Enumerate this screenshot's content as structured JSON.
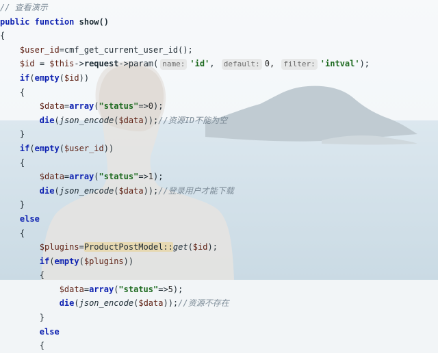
{
  "code": {
    "comment_title": "// 查看演示",
    "func_decl_kw1": "public",
    "func_decl_kw2": "function",
    "func_name": "show()",
    "open_brace": "{",
    "close_brace": "}",
    "line_user_id_var": "$user_id",
    "line_user_id_call": "=cmf_get_current_user_id();",
    "line_id_var": "$id",
    "line_id_eq": " = ",
    "line_id_this": "$this",
    "line_id_arrow": "->",
    "line_id_request": "request",
    "line_id_param": "param(",
    "hint_name": "name:",
    "hint_default": "default:",
    "hint_filter": "filter:",
    "arg_id": "'id'",
    "arg_zero": "0,",
    "arg_intval": "'intval'",
    "line_id_end": ");",
    "kw_if": "if",
    "kw_else": "else",
    "kw_empty": "empty",
    "kw_array": "array",
    "kw_die": "die",
    "paren_open": "(",
    "paren_close": ")",
    "var_id": "$id",
    "var_user_id": "$user_id",
    "var_data": "$data",
    "var_plugins": "$plugins",
    "str_status": "\"status\"",
    "fat_arrow": "=>",
    "val_0": "0",
    "val_1": "1",
    "val_5": "5",
    "json_encode": "json_encode",
    "comment_1": "//资源ID不能为空",
    "comment_2": "//登录用户才能下载",
    "comment_3": "//资源不存在",
    "model_call": "ProductPostModel::",
    "model_get": "get",
    "eq": "=",
    "semi": ";",
    "end_array": ");",
    "end_die": ");",
    "end_plugins": ");"
  }
}
